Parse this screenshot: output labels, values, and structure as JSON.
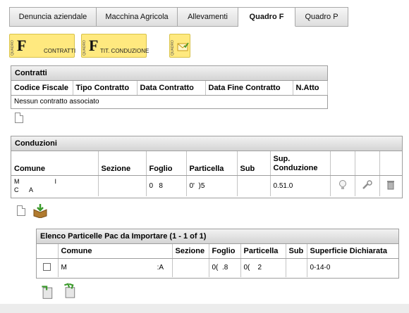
{
  "tabs": [
    {
      "label": "Denuncia aziendale",
      "active": false
    },
    {
      "label": "Macchina Agricola",
      "active": false
    },
    {
      "label": "Allevamenti",
      "active": false
    },
    {
      "label": "Quadro F",
      "active": true
    },
    {
      "label": "Quadro P",
      "active": false
    }
  ],
  "quadro_buttons": {
    "strip_label": "QUADRO",
    "contratti": {
      "letter": "F",
      "label": "CONTRATTI"
    },
    "conduzione": {
      "letter": "F",
      "label": "TIT. CONDUZIONE"
    },
    "third_icon": "envelope-check-icon"
  },
  "contratti": {
    "title": "Contratti",
    "columns": [
      "Codice Fiscale",
      "Tipo Contratto",
      "Data Contratto",
      "Data Fine Contratto",
      "N.Atto"
    ],
    "empty_message": "Nessun contratto associato"
  },
  "conduzioni": {
    "title": "Conduzioni",
    "columns": [
      "Comune",
      "Sezione",
      "Foglio",
      "Particella",
      "Sub",
      "Sup. Conduzione",
      "",
      "",
      ""
    ],
    "rows": [
      {
        "comune_line1": "M                    I",
        "comune_line2": "C      A",
        "sezione": "",
        "foglio": "0   8",
        "particella": "0'  )5",
        "sub": "",
        "superficie": "0.51.0",
        "icons": [
          "lightbulb-icon",
          "wrench-icon",
          "trash-icon"
        ]
      }
    ]
  },
  "particelle_pac": {
    "title": "Elenco Particelle Pac da Importare (1 - 1 of 1)",
    "columns": [
      "",
      "Comune",
      "Sezione",
      "Foglio",
      "Particella",
      "Sub",
      "Superficie Dichiarata"
    ],
    "rows": [
      {
        "checked": false,
        "comune": "M                                              :A",
        "sezione": "",
        "foglio": "0(  .8",
        "particella": "0(    2",
        "sub": "",
        "superficie": "0-14-0"
      }
    ]
  },
  "colors": {
    "tab_active_bg": "#ffffff",
    "panel_header_bg": "#d4d4d4",
    "quadro_button_bg": "#ffe97f",
    "border": "#9e9e9e"
  }
}
